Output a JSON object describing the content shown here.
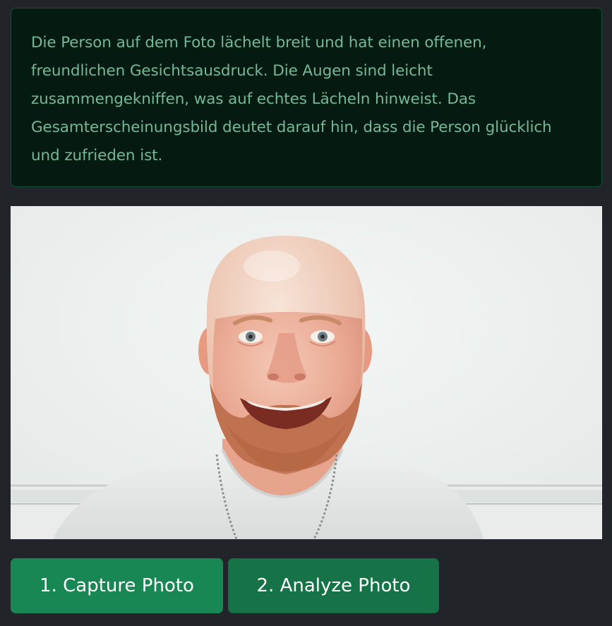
{
  "analysis": {
    "text": "Die Person auf dem Foto lächelt breit und hat einen offenen, freundlichen Gesichtsausdruck. Die Augen sind leicht zusammengekniffen, was auf echtes Lächeln hinweist. Das Gesamterscheinungsbild deutet darauf hin, dass die Person glücklich und zufrieden ist."
  },
  "actions": {
    "capture_label": "1. Capture Photo",
    "analyze_label": "2. Analyze Photo"
  },
  "colors": {
    "background": "#212529",
    "alert_background": "#051b11",
    "alert_border": "#0f5132",
    "alert_text": "#75b798",
    "button_primary": "#198754",
    "button_active": "#157347"
  }
}
